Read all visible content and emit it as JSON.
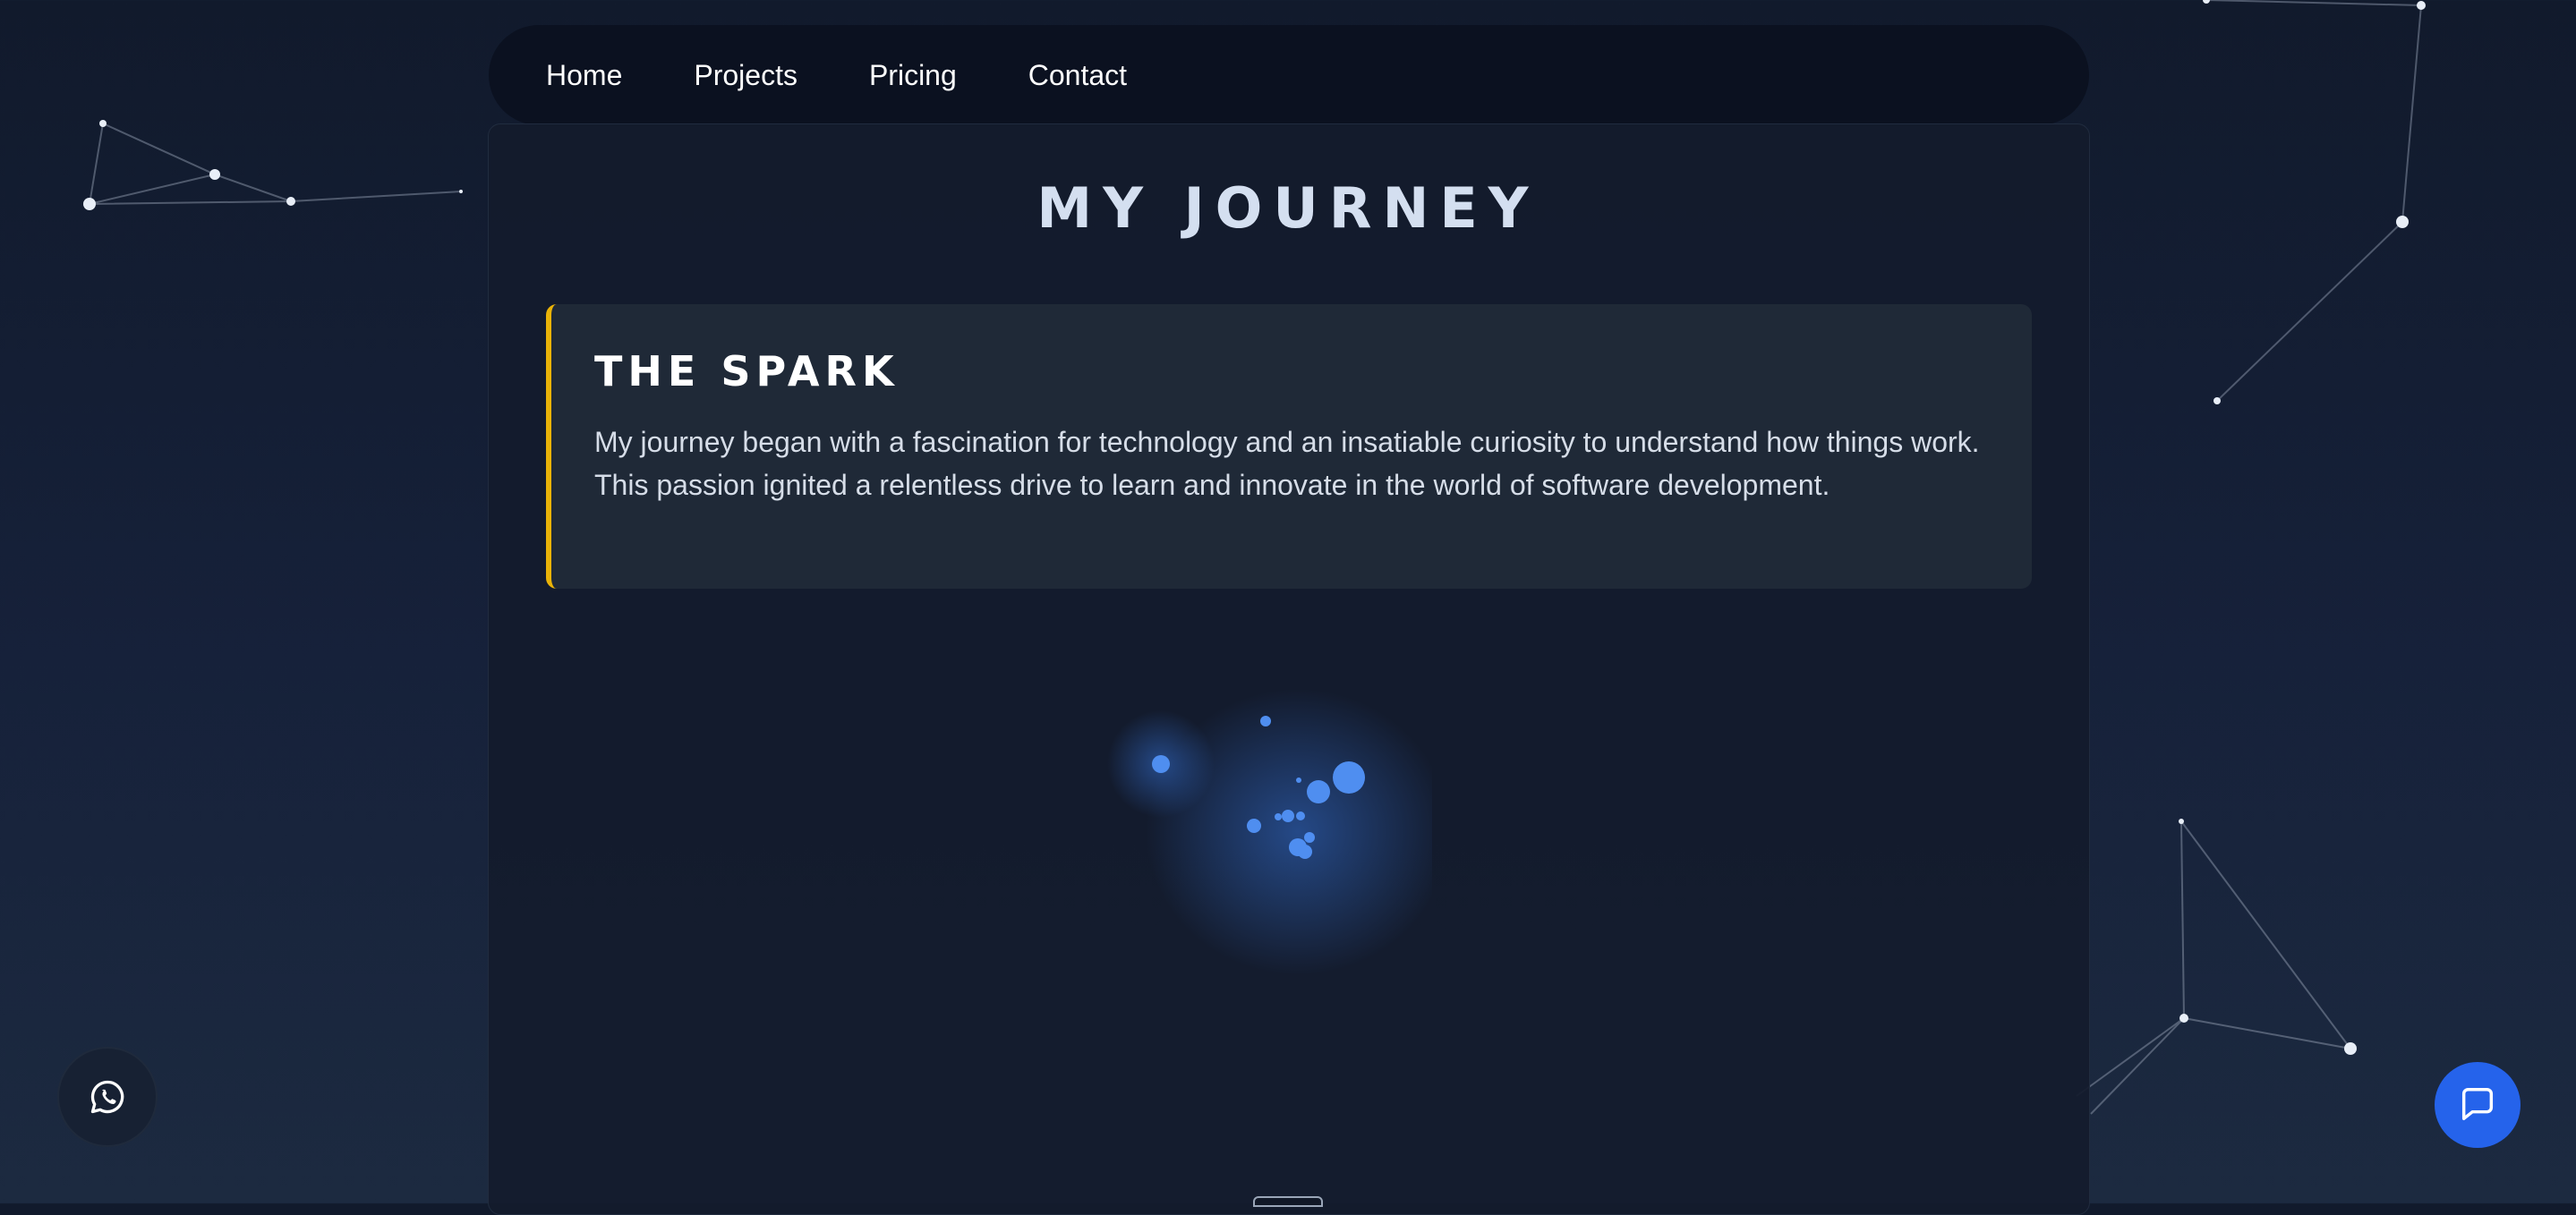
{
  "nav": {
    "items": [
      {
        "label": "Home"
      },
      {
        "label": "Projects"
      },
      {
        "label": "Pricing"
      },
      {
        "label": "Contact"
      }
    ]
  },
  "page": {
    "title": "MY JOURNEY"
  },
  "card": {
    "heading": "THE SPARK",
    "body": "My journey began with a fascination for technology and an insatiable curiosity to understand how things work. This passion ignited a relentless drive to learn and innovate in the world of software development.",
    "accent_color": "#eab308"
  },
  "floating": {
    "whatsapp_icon": "whatsapp-icon",
    "chat_icon": "chat-bubble-icon",
    "chat_color": "#2563eb"
  }
}
